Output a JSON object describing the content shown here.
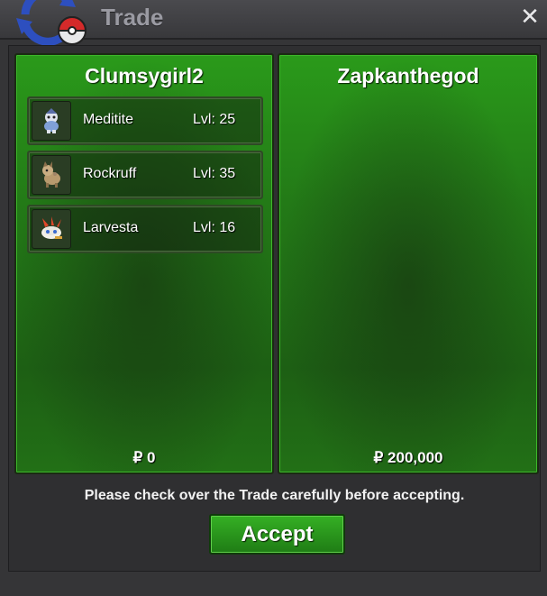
{
  "window": {
    "title": "Trade"
  },
  "players": [
    {
      "name": "Clumsygirl2",
      "money": "₽ 0",
      "pokemon": [
        {
          "name": "Meditite",
          "level": "Lvl: 25",
          "icon": "meditite-icon"
        },
        {
          "name": "Rockruff",
          "level": "Lvl: 35",
          "icon": "rockruff-icon"
        },
        {
          "name": "Larvesta",
          "level": "Lvl: 16",
          "icon": "larvesta-icon"
        }
      ]
    },
    {
      "name": "Zapkanthegod",
      "money": "₽ 200,000",
      "pokemon": []
    }
  ],
  "footer": {
    "notice": "Please check over the Trade carefully before accepting.",
    "accept_label": "Accept"
  },
  "colors": {
    "panel_green": "#237a17",
    "button_green": "#2c9a1f",
    "window_bg": "#353537"
  }
}
